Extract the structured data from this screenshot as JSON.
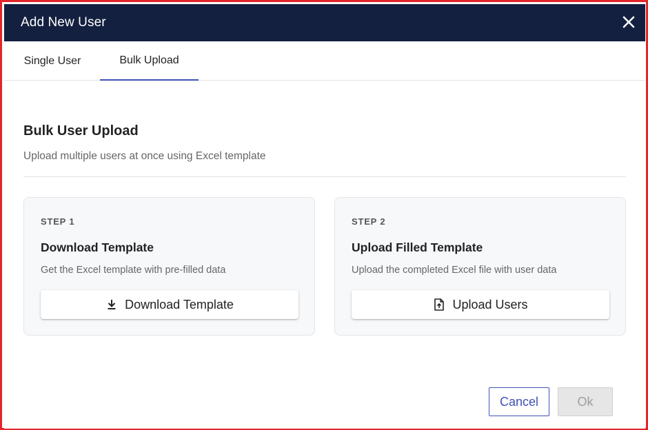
{
  "dialog": {
    "title": "Add New User",
    "close_icon": "close-icon"
  },
  "tabs": [
    {
      "label": "Single User",
      "active": false
    },
    {
      "label": "Bulk Upload",
      "active": true
    }
  ],
  "main": {
    "heading": "Bulk User Upload",
    "subheading": "Upload multiple users at once using Excel template"
  },
  "steps": [
    {
      "step": "STEP 1",
      "title": "Download Template",
      "description": "Get the Excel template with pre-filled data",
      "button_label": "Download Template",
      "button_icon": "download-icon"
    },
    {
      "step": "STEP 2",
      "title": "Upload Filled Template",
      "description": "Upload the completed Excel file with user data",
      "button_label": "Upload Users",
      "button_icon": "file-upload-icon"
    }
  ],
  "footer": {
    "cancel_label": "Cancel",
    "ok_label": "Ok",
    "ok_disabled": true
  },
  "colors": {
    "header_bg": "#13203f",
    "accent": "#3f51b5",
    "frame_border": "#e3262a"
  }
}
